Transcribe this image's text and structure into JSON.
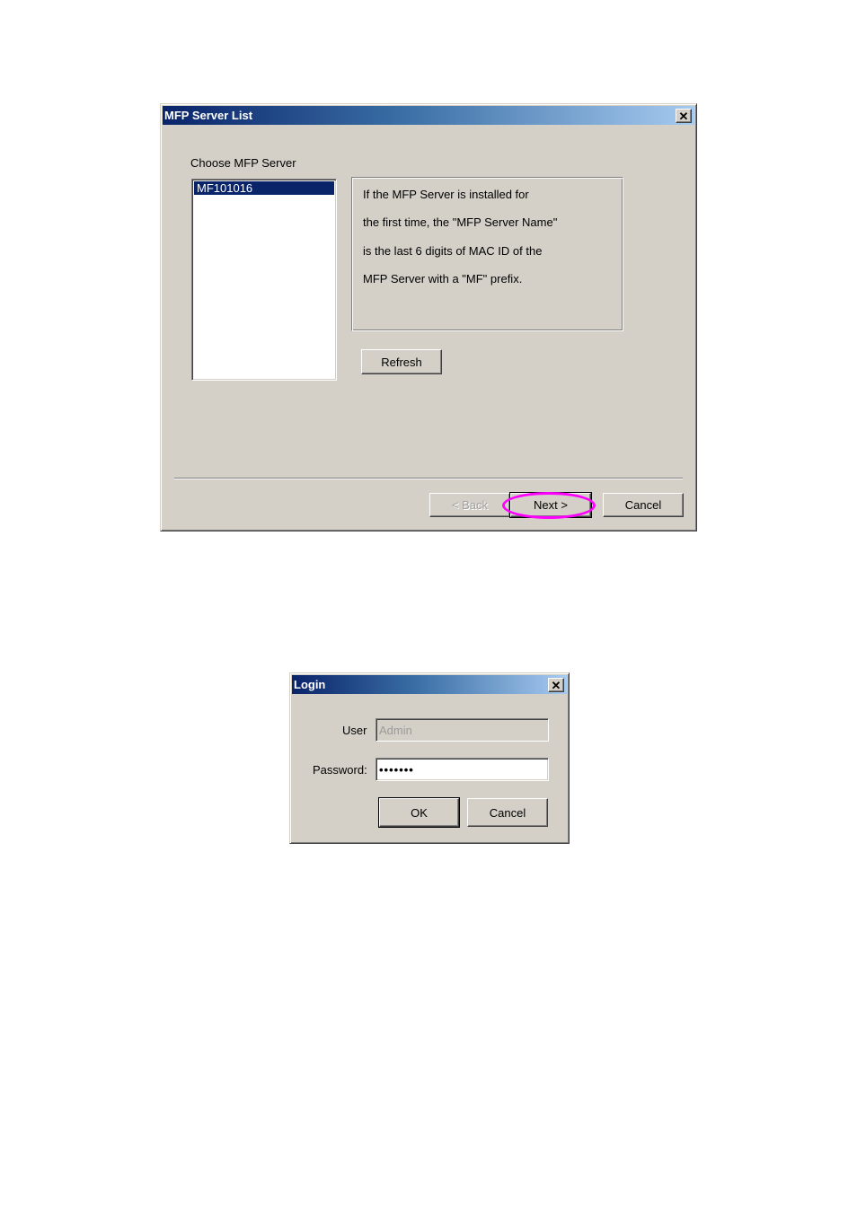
{
  "mfp_dialog": {
    "title": "MFP Server List",
    "close_icon": "close-icon",
    "choose_label": "Choose MFP Server",
    "servers": [
      "MF101016"
    ],
    "selected_server": "MF101016",
    "info_lines": [
      "If the MFP Server is installed for",
      "the first time, the \"MFP Server Name\"",
      "is the last 6 digits of MAC ID of the",
      "MFP Server with a \"MF\" prefix."
    ],
    "refresh_label": "Refresh",
    "back_label": "< Back",
    "next_label": "Next >",
    "cancel_label": "Cancel",
    "highlight_color": "#ff00ff"
  },
  "login_dialog": {
    "title": "Login",
    "close_icon": "close-icon",
    "user_label": "User",
    "user_value": "Admin",
    "password_label": "Password:",
    "password_value": "•••••••",
    "ok_label": "OK",
    "cancel_label": "Cancel"
  }
}
